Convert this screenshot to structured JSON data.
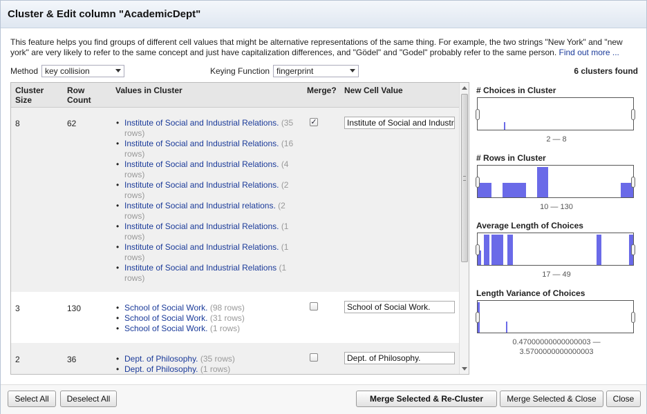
{
  "dialog": {
    "title": "Cluster & Edit column \"AcademicDept\""
  },
  "description": {
    "text": "This feature helps you find groups of different cell values that might be alternative representations of the same thing. For example, the two strings \"New York\" and \"new york\" are very likely to refer to the same concept and just have capitalization differences, and \"Gödel\" and \"Godel\" probably refer to the same person.",
    "link": "Find out more ..."
  },
  "controls": {
    "method_label": "Method",
    "method_value": "key collision",
    "keying_label": "Keying Function",
    "keying_value": "fingerprint",
    "clusters_found": "6 clusters found"
  },
  "table": {
    "headers": {
      "size": "Cluster Size",
      "count": "Row Count",
      "values": "Values in Cluster",
      "merge": "Merge?",
      "newval": "New Cell Value"
    },
    "rows": [
      {
        "size": "8",
        "count": "62",
        "merge": true,
        "new_value": "Institute of Social and Industrial Relations.",
        "values": [
          {
            "v": "Institute of Social and Industrial Relations.",
            "c": "(35 rows)"
          },
          {
            "v": " Institute of Social and Industrial Relations.",
            "c": "(16 rows)"
          },
          {
            "v": "Institute of Social and Industrial Relations.",
            "c": "(4 rows)"
          },
          {
            "v": " Institute of Social and Industrial Relations.",
            "c": "(2 rows)"
          },
          {
            "v": " Institute of Social and Industrial relations.",
            "c": "(2 rows)"
          },
          {
            "v": " Institute of Social and Industrial Relations.",
            "c": "(1 rows)"
          },
          {
            "v": " Institute of Social and Industrial Relations. ",
            "c": "(1 rows)"
          },
          {
            "v": "Institute of Social and Industrial Relations",
            "c": "(1 rows)"
          }
        ]
      },
      {
        "size": "3",
        "count": "130",
        "merge": false,
        "new_value": "School of Social Work.",
        "values": [
          {
            "v": "School of Social Work.",
            "c": "(98 rows)"
          },
          {
            "v": " School of Social Work.",
            "c": "(31 rows)"
          },
          {
            "v": "School of Social Work. ",
            "c": "(1 rows)"
          }
        ]
      },
      {
        "size": "2",
        "count": "36",
        "merge": false,
        "new_value": "Dept. of Philosophy.",
        "values": [
          {
            "v": "Dept. of Philosophy.",
            "c": "(35 rows)"
          },
          {
            "v": "Dept. of Philosophy.",
            "c": "(1 rows)"
          }
        ]
      }
    ]
  },
  "facets": [
    {
      "title": "# Choices in Cluster",
      "range": "2 — 8",
      "bars": [
        {
          "from": 0.167,
          "to": 0.175,
          "h": 0.25
        }
      ]
    },
    {
      "title": "# Rows in Cluster",
      "range": "10 — 130",
      "bars": [
        {
          "from": 0.0,
          "to": 0.09,
          "h": 0.45
        },
        {
          "from": 0.16,
          "to": 0.31,
          "h": 0.45
        },
        {
          "from": 0.38,
          "to": 0.455,
          "h": 0.95
        },
        {
          "from": 0.92,
          "to": 1.0,
          "h": 0.45
        }
      ]
    },
    {
      "title": "Average Length of Choices",
      "range": "17 — 49",
      "bars": [
        {
          "from": 0.0,
          "to": 0.02,
          "h": 0.45
        },
        {
          "from": 0.04,
          "to": 0.075,
          "h": 0.95
        },
        {
          "from": 0.09,
          "to": 0.165,
          "h": 0.95
        },
        {
          "from": 0.19,
          "to": 0.225,
          "h": 0.95
        },
        {
          "from": 0.765,
          "to": 0.795,
          "h": 0.95
        },
        {
          "from": 0.975,
          "to": 1.0,
          "h": 0.95
        }
      ]
    },
    {
      "title": "Length Variance of Choices",
      "range": "0.47000000000000003 — 3.5700000000000003",
      "bars": [
        {
          "from": 0.0,
          "to": 0.012,
          "h": 0.95
        },
        {
          "from": 0.182,
          "to": 0.192,
          "h": 0.35
        }
      ]
    }
  ],
  "footer": {
    "select_all": "Select All",
    "deselect_all": "Deselect All",
    "merge_recluster": "Merge Selected & Re-Cluster",
    "merge_close": "Merge Selected & Close",
    "close": "Close"
  },
  "colors": {
    "bar": "#6a6ae8",
    "link": "#1a3a99",
    "count": "#999999"
  }
}
